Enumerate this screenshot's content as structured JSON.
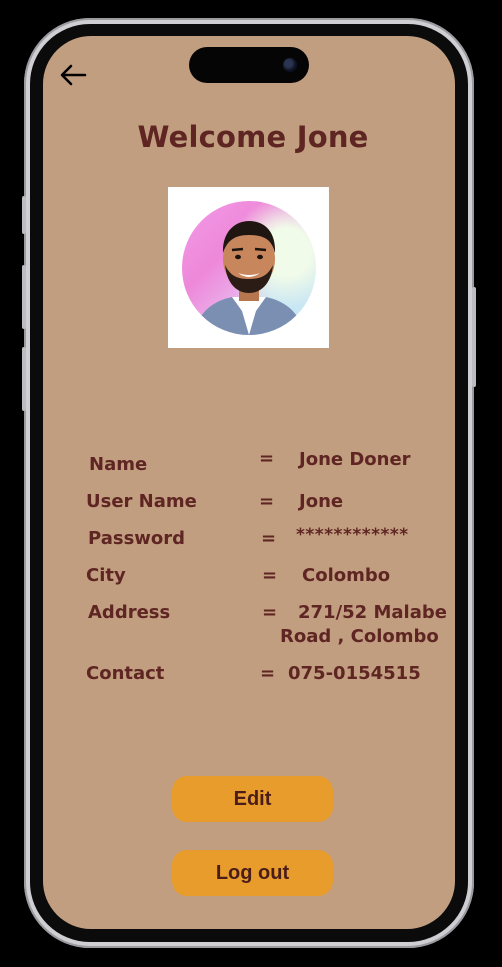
{
  "header": {
    "title": "Welcome Jone"
  },
  "profile": {
    "rows": [
      {
        "label": "Name",
        "sep": "=",
        "value": "Jone Doner"
      },
      {
        "label": "User Name",
        "sep": "=",
        "value": "Jone"
      },
      {
        "label": "Password",
        "sep": "=",
        "value": "************"
      },
      {
        "label": "City",
        "sep": "=",
        "value": "Colombo"
      },
      {
        "label": "Address",
        "sep": "=",
        "value_line1": "271/52 Malabe",
        "value_line2": "Road , Colombo"
      },
      {
        "label": "Contact",
        "sep": "=",
        "value": "075-0154515"
      }
    ]
  },
  "actions": {
    "edit_label": "Edit",
    "logout_label": "Log out"
  },
  "icons": {
    "back": "back-arrow-icon"
  },
  "colors": {
    "screen_bg": "#c29e80",
    "text": "#5e2522",
    "button_bg": "#e89c2b",
    "button_text": "#4b1d1a"
  }
}
